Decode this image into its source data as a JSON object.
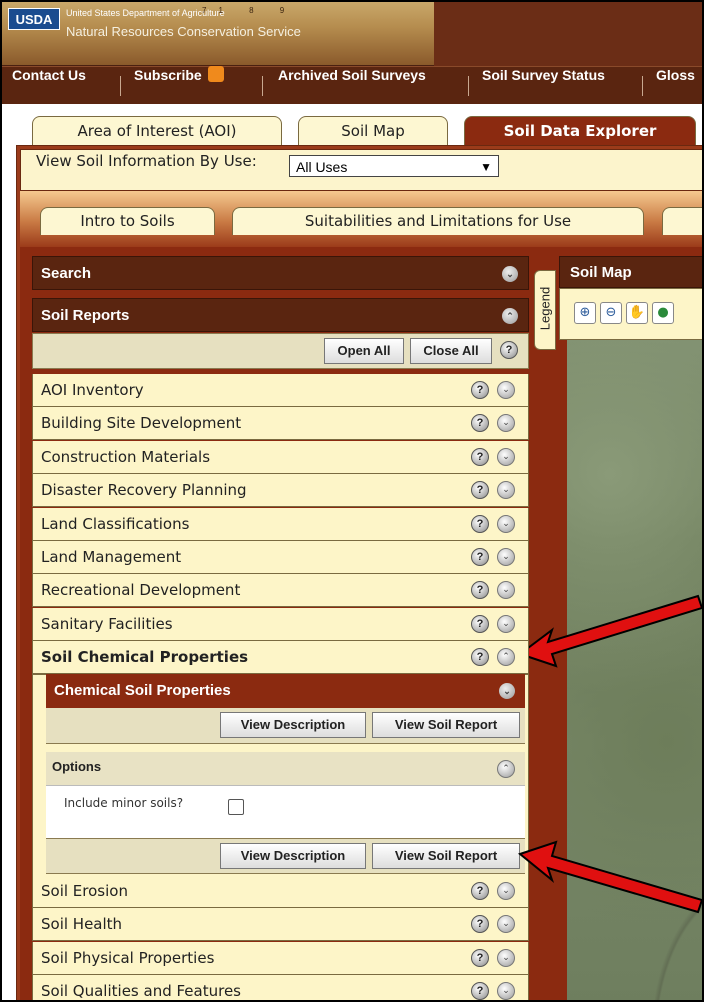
{
  "banner": {
    "logo": "USDA",
    "agency_line1": "United States Department of Agriculture",
    "agency_line2": "Natural Resources Conservation Service",
    "ruler_marks": "71 8 9"
  },
  "topnav": {
    "items": [
      "Contact Us",
      "Subscribe",
      "Archived Soil Surveys",
      "Soil Survey Status",
      "Gloss"
    ]
  },
  "main_tabs": [
    "Area of Interest (AOI)",
    "Soil Map",
    "Soil Data Explorer"
  ],
  "use_selector": {
    "label": "View Soil Information By Use:",
    "value": "All Uses"
  },
  "sub_tabs": [
    "Intro to Soils",
    "Suitabilities and Limitations for Use"
  ],
  "left_panel": {
    "search_label": "Search",
    "reports_label": "Soil Reports",
    "open_all": "Open All",
    "close_all": "Close All",
    "rows_before": [
      "AOI Inventory",
      "Building Site Development",
      "Construction Materials",
      "Disaster Recovery Planning",
      "Land Classifications",
      "Land Management",
      "Recreational Development",
      "Sanitary Facilities",
      "Soil Chemical Properties"
    ],
    "chemical": {
      "title": "Chemical Soil Properties",
      "view_description": "View Description",
      "view_report": "View Soil Report",
      "options_label": "Options",
      "minor_soils_label": "Include minor soils?"
    },
    "rows_after": [
      "Soil Erosion",
      "Soil Health",
      "Soil Physical Properties",
      "Soil Qualities and Features"
    ]
  },
  "legend_tab": "Legend",
  "map": {
    "title": "Soil Map"
  },
  "colors": {
    "arrow": "#e01010",
    "panel_brown": "#8b2a10",
    "header_dark": "#5a2510",
    "row_cream": "#fdf5c8"
  }
}
